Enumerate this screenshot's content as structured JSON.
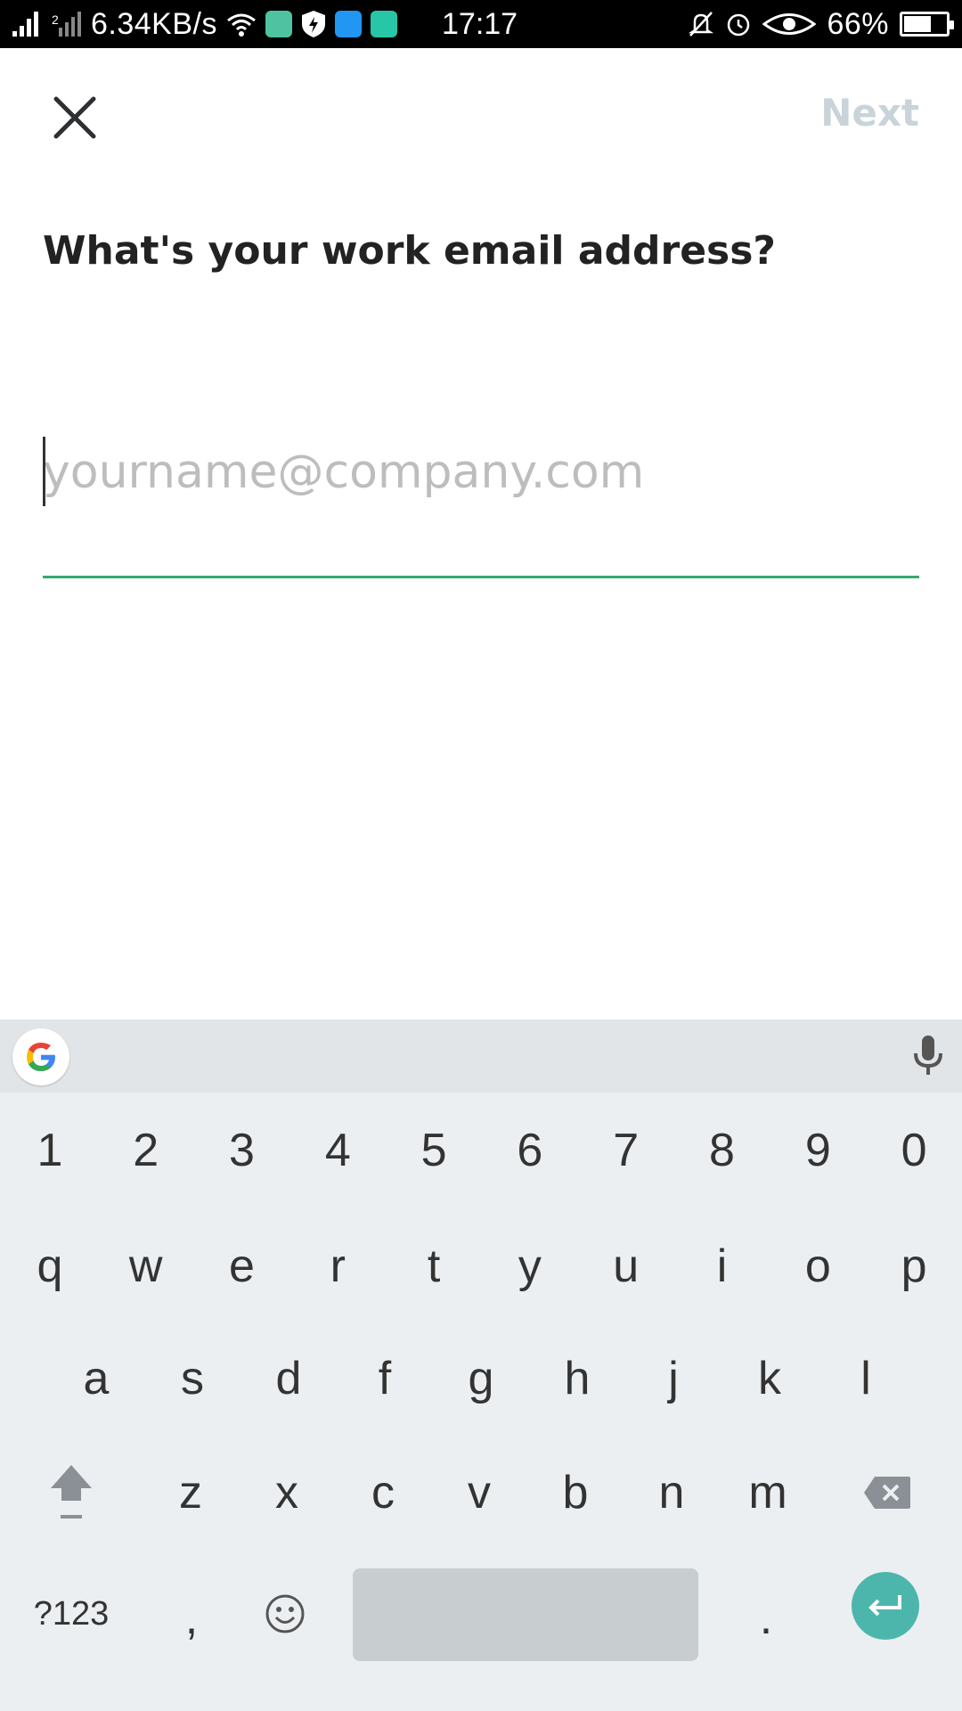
{
  "status_bar": {
    "net_speed": "6.34KB/s",
    "time": "17:17",
    "battery_percent": "66%",
    "battery_level": 0.66,
    "icons": [
      "signal-icon",
      "signal-2-icon",
      "wifi-icon",
      "app-notification-icon",
      "shield-icon",
      "message-icon",
      "location-icon",
      "mute-icon",
      "alarm-icon",
      "eye-icon",
      "battery-icon"
    ]
  },
  "header": {
    "close_icon": "close-icon",
    "next_label": "Next"
  },
  "form": {
    "question": "What's your work email address?",
    "email_value": "",
    "email_placeholder": "yourname@company.com",
    "accent_color": "#3aa871"
  },
  "keyboard": {
    "number_row": [
      "1",
      "2",
      "3",
      "4",
      "5",
      "6",
      "7",
      "8",
      "9",
      "0"
    ],
    "row1": [
      "q",
      "w",
      "e",
      "r",
      "t",
      "y",
      "u",
      "i",
      "o",
      "p"
    ],
    "row2": [
      "a",
      "s",
      "d",
      "f",
      "g",
      "h",
      "j",
      "k",
      "l"
    ],
    "row3": [
      "z",
      "x",
      "c",
      "v",
      "b",
      "n",
      "m"
    ],
    "symbols_label": "?123",
    "comma_label": ",",
    "period_label": ".",
    "enter_color": "#4db6ac"
  }
}
